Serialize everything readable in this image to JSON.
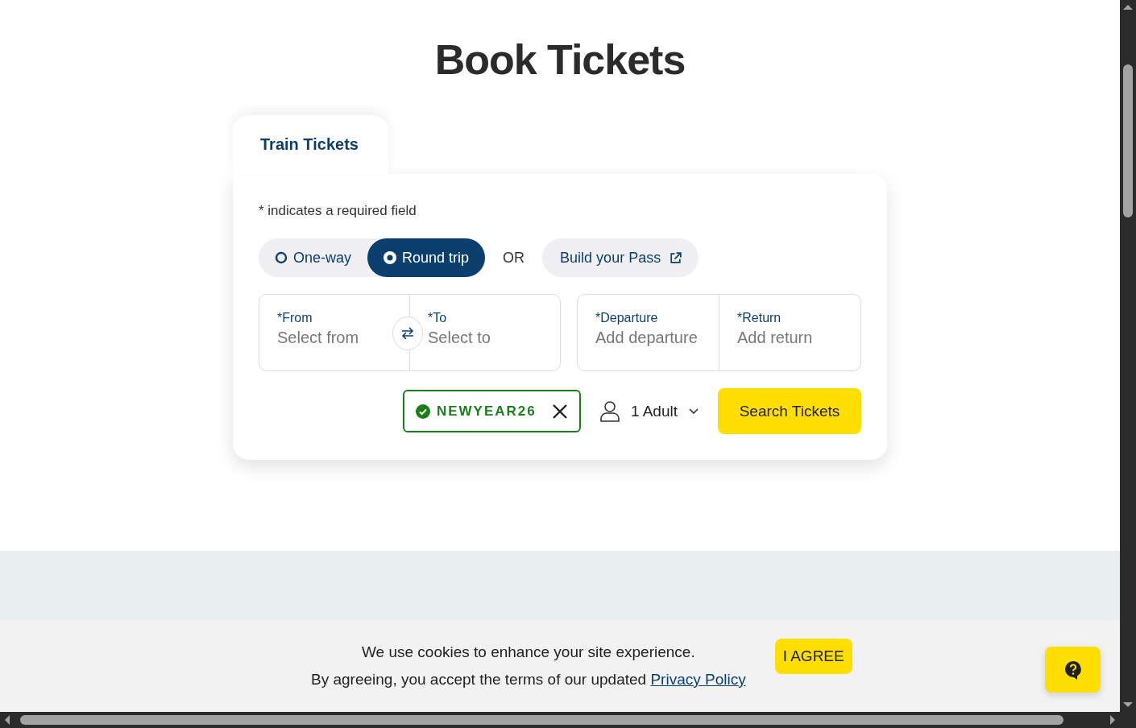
{
  "page": {
    "title": "Book Tickets"
  },
  "tabs": [
    {
      "label": "Train Tickets",
      "selected": true
    }
  ],
  "form": {
    "required_note": "* indicates a required field",
    "trip_types": [
      {
        "label": "One-way",
        "selected": false
      },
      {
        "label": "Round trip",
        "selected": true
      }
    ],
    "or_label": "OR",
    "pass_link": {
      "label": "Build your Pass"
    },
    "location_fields": [
      {
        "required_mark": "*",
        "label": "From",
        "placeholder": "Select from"
      },
      {
        "required_mark": "*",
        "label": "To",
        "placeholder": "Select to"
      }
    ],
    "date_fields": [
      {
        "required_mark": "*",
        "label": "Departure",
        "placeholder": "Add departure"
      },
      {
        "required_mark": "*",
        "label": "Return",
        "placeholder": "Add return"
      }
    ],
    "promo_code": {
      "code": "NEWYEAR26",
      "applied": true
    },
    "passengers": {
      "label": "1 Adult"
    },
    "search_button": "Search Tickets"
  },
  "section": {
    "kind": "band"
  },
  "cookie_banner": {
    "title": "We use cookies to enhance your site experience.",
    "text": "By agreeing, you accept the terms of our updated ",
    "link": "Privacy Policy",
    "button": "I AGREE"
  }
}
